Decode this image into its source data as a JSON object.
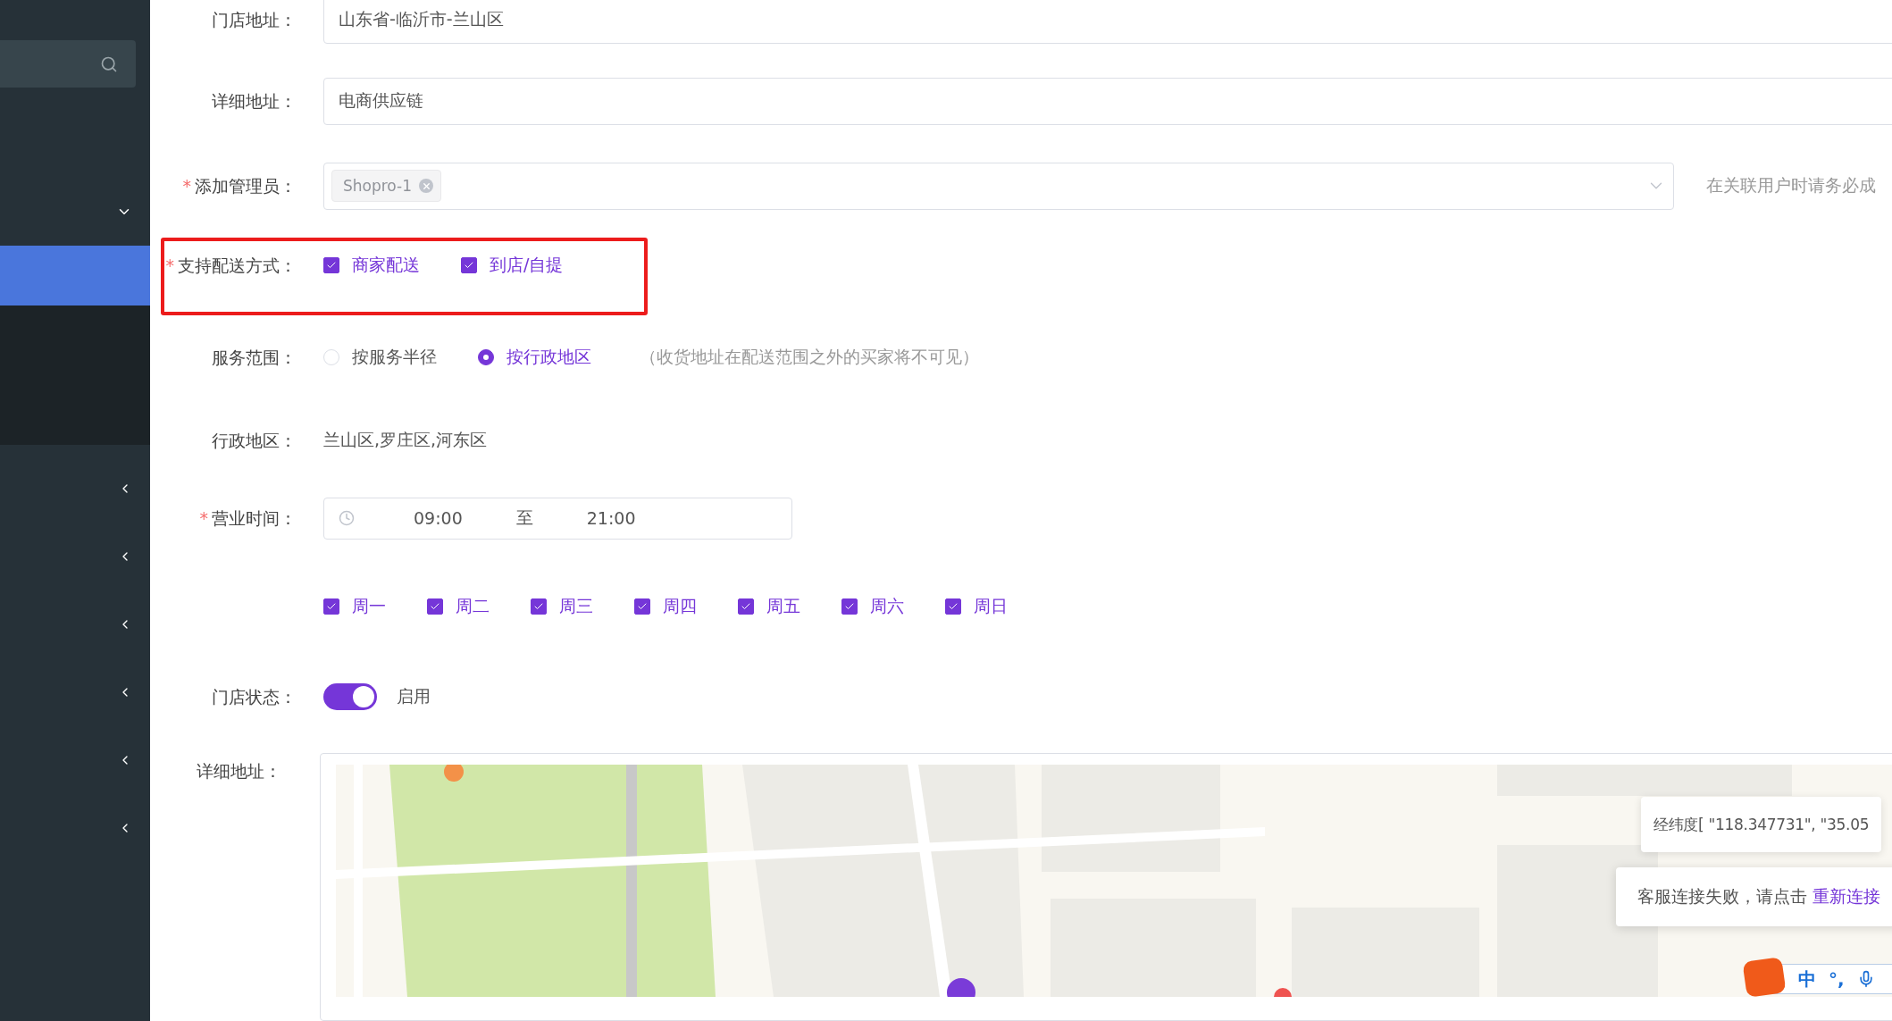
{
  "form": {
    "required_mark": "*",
    "fields": [
      {
        "kind": "text",
        "label": "门店地址：",
        "required": false,
        "value": "山东省-临沂市-兰山区"
      },
      {
        "kind": "text",
        "label": "详细地址：",
        "required": false,
        "value": "电商供应链"
      },
      {
        "kind": "tags",
        "label": "添加管理员：",
        "required": true,
        "tags": [
          "Shopro-1"
        ],
        "hint": "在关联用户时请务必成"
      },
      {
        "kind": "checkboxes",
        "label": "支持配送方式：",
        "required": true,
        "highlighted": true,
        "options": [
          {
            "label": "商家配送",
            "checked": true
          },
          {
            "label": "到店/自提",
            "checked": true
          }
        ]
      },
      {
        "kind": "radios",
        "label": "服务范围：",
        "required": false,
        "options": [
          {
            "label": "按服务半径",
            "selected": false
          },
          {
            "label": "按行政地区",
            "selected": true
          }
        ],
        "note": "（收货地址在配送范围之外的买家将不可见）"
      },
      {
        "kind": "plain",
        "label": "行政地区：",
        "required": false,
        "value": "兰山区,罗庄区,河东区"
      },
      {
        "kind": "timerange",
        "label": "营业时间：",
        "required": true,
        "start": "09:00",
        "separator": "至",
        "end": "21:00"
      },
      {
        "kind": "checkboxes",
        "required": false,
        "options": [
          {
            "label": "周一",
            "checked": true
          },
          {
            "label": "周二",
            "checked": true
          },
          {
            "label": "周三",
            "checked": true
          },
          {
            "label": "周四",
            "checked": true
          },
          {
            "label": "周五",
            "checked": true
          },
          {
            "label": "周六",
            "checked": true
          },
          {
            "label": "周日",
            "checked": true
          }
        ]
      },
      {
        "kind": "switch",
        "label": "门店状态：",
        "required": false,
        "on": true,
        "text": "启用"
      },
      {
        "kind": "map",
        "label": "详细地址：",
        "required": false,
        "coords": "经纬度[ \"118.347731\", \"35.05",
        "toast": {
          "text": "客服连接失败，请点击",
          "link": "重新连接"
        }
      }
    ]
  },
  "ime_toolbar": {
    "mode": "中",
    "punctuation": "°,"
  }
}
